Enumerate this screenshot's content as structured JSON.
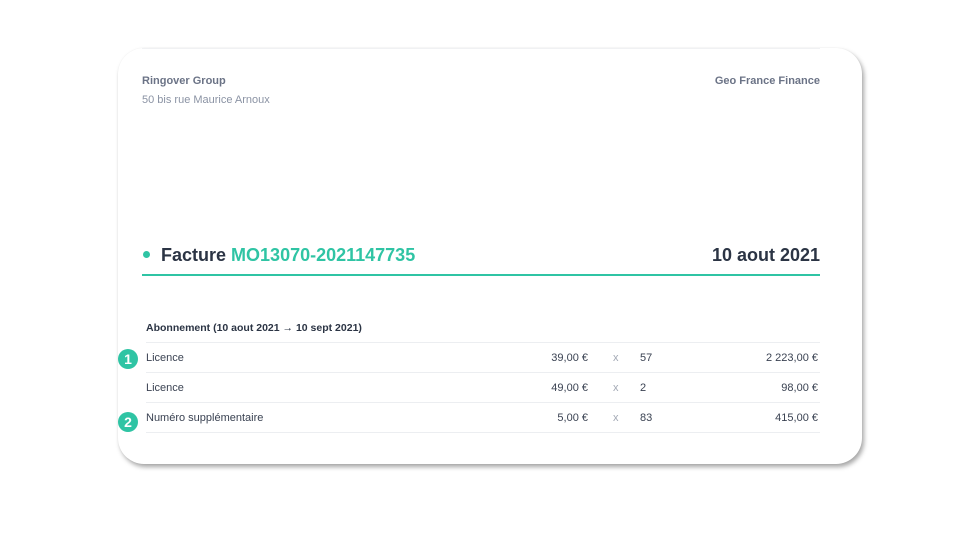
{
  "seller": {
    "name": "Ringover Group",
    "address": "50 bis rue Maurice Arnoux"
  },
  "client": {
    "name": "Geo France Finance"
  },
  "invoice": {
    "label": "Facture",
    "number": "MO13070-2021147735",
    "date": "10 aout 2021"
  },
  "section": {
    "title": "Abonnement (10 aout 2021 → 10 sept 2021)"
  },
  "lines": [
    {
      "label": "Licence",
      "unit_price": "39,00 €",
      "times": "x",
      "quantity": "57",
      "total": "2 223,00 €"
    },
    {
      "label": "Licence",
      "unit_price": "49,00 €",
      "times": "x",
      "quantity": "2",
      "total": "98,00 €"
    },
    {
      "label": "Numéro supplémentaire",
      "unit_price": "5,00 €",
      "times": "x",
      "quantity": "83",
      "total": "415,00 €"
    }
  ],
  "markers": [
    {
      "label": "1"
    },
    {
      "label": "2"
    }
  ],
  "colors": {
    "accent": "#2fc4a4",
    "text": "#2b3444",
    "muted": "#6b7386"
  }
}
